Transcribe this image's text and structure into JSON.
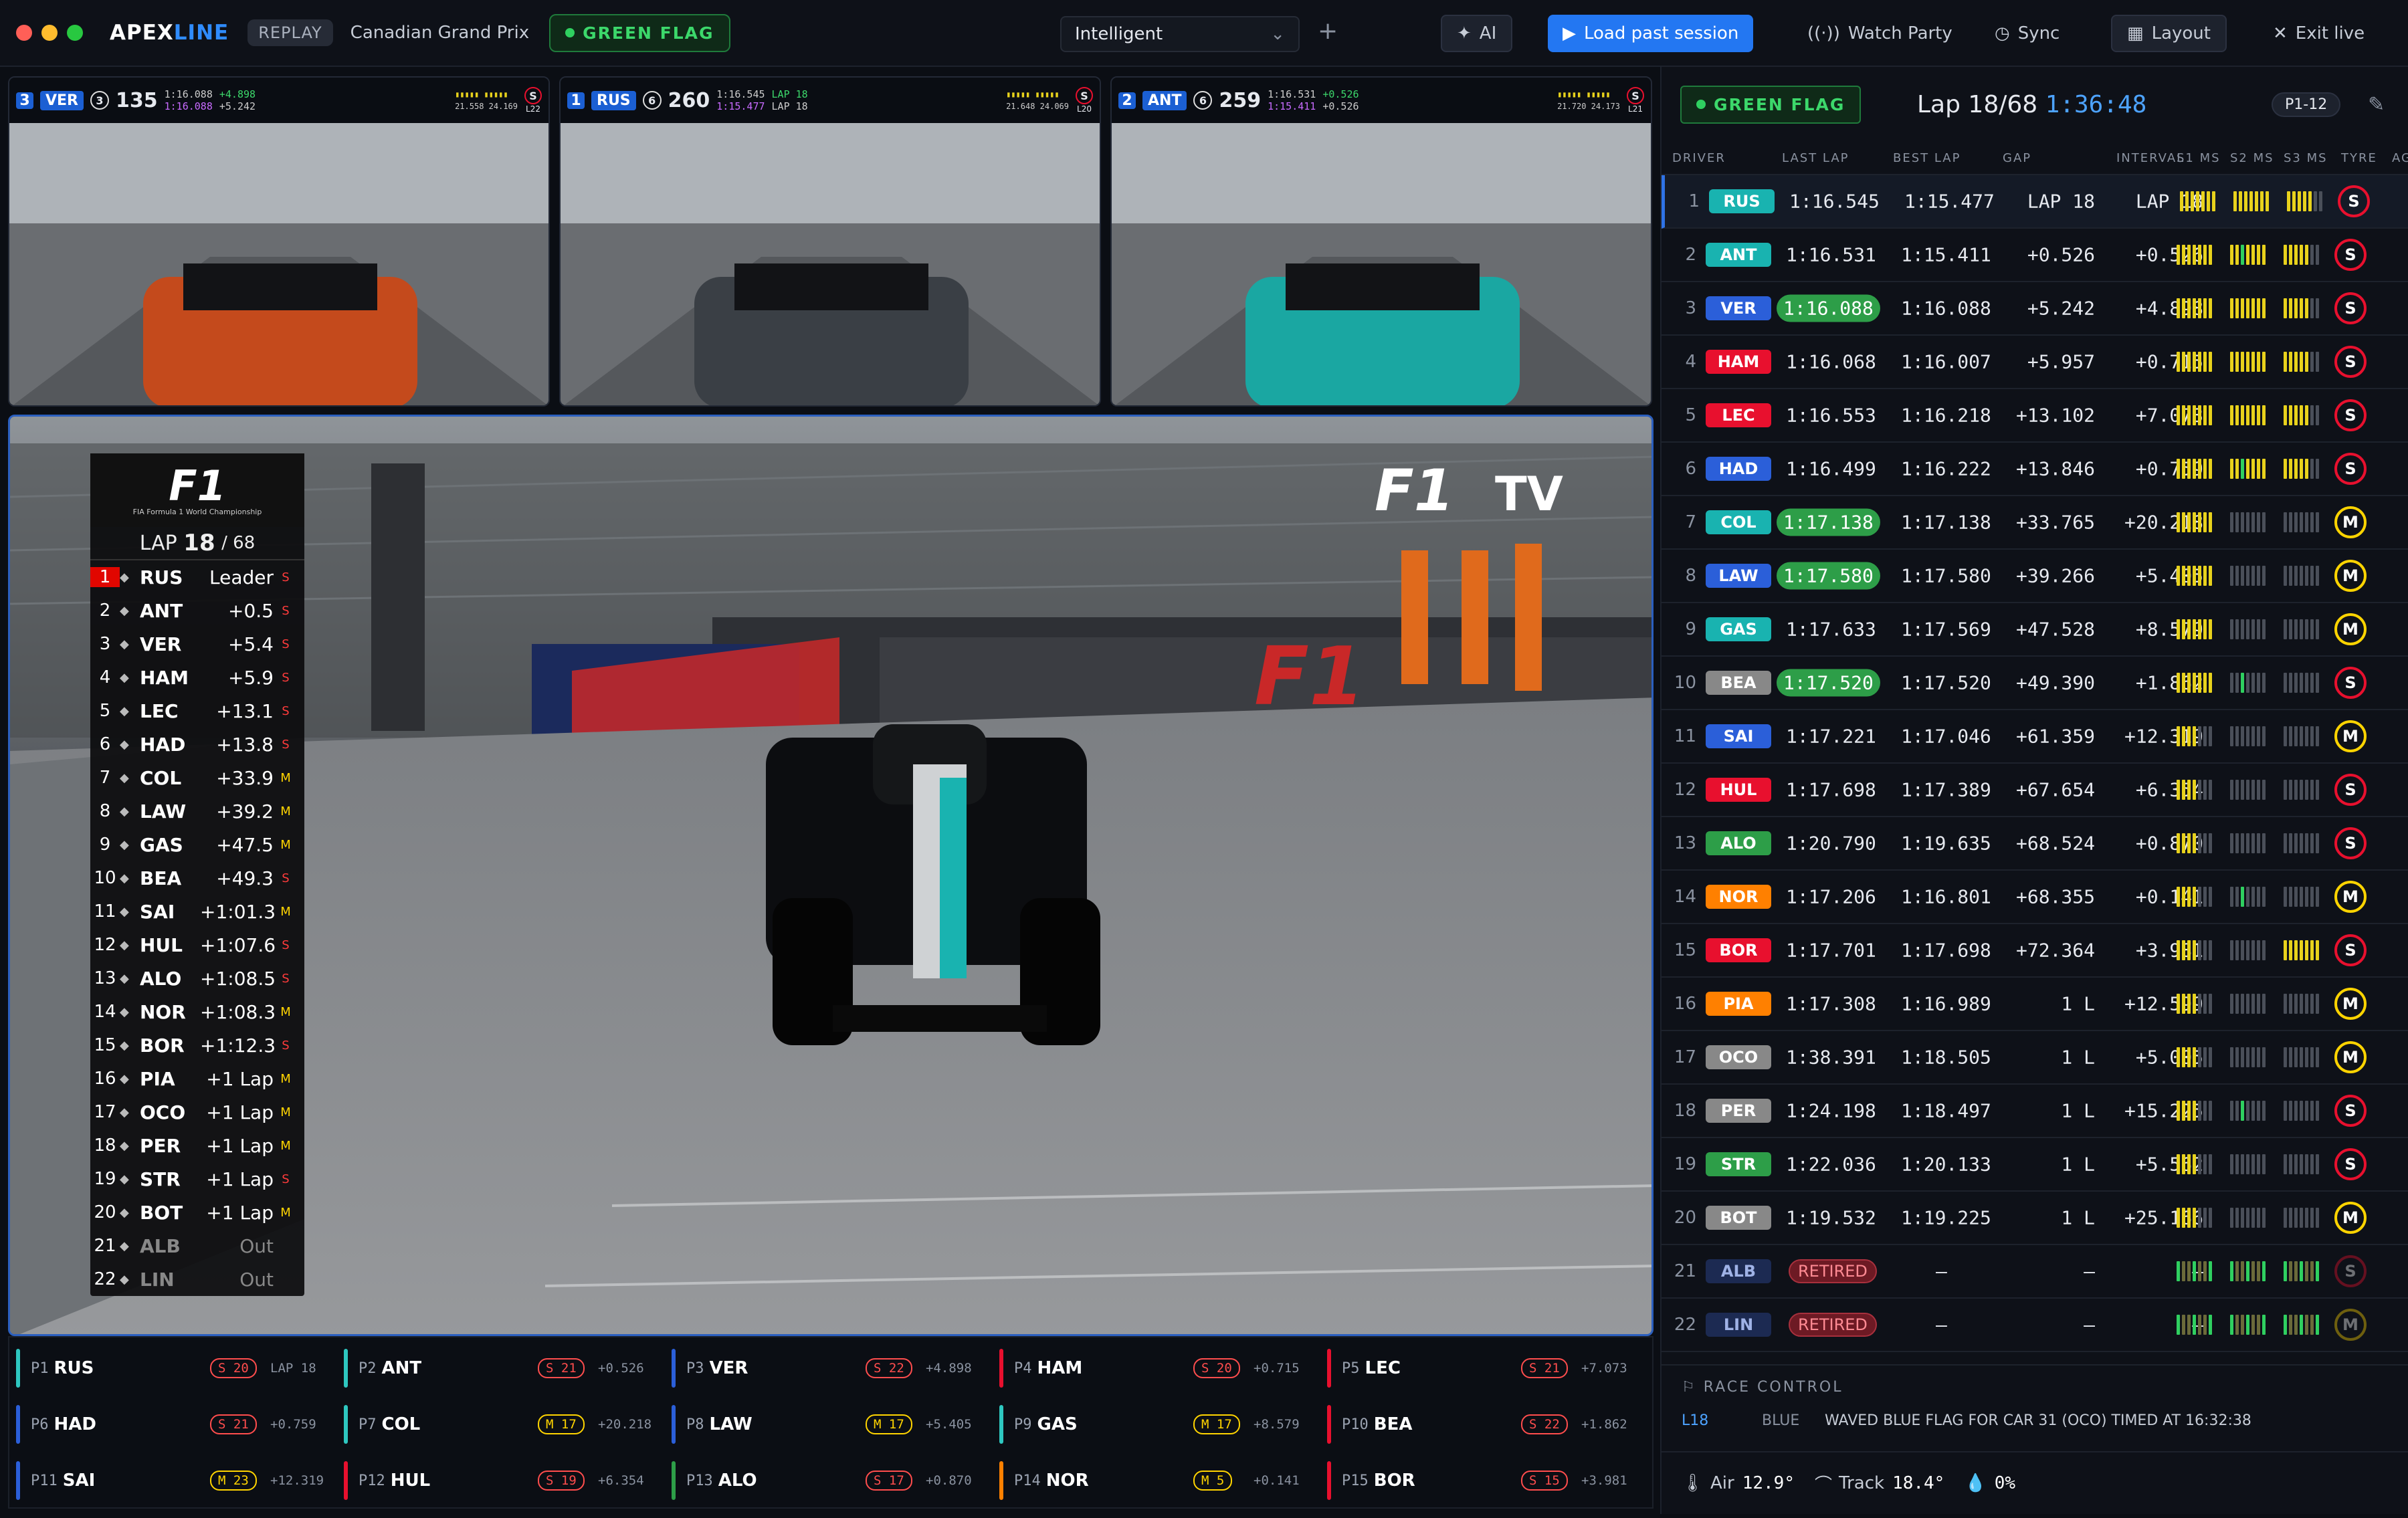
{
  "app": {
    "brand_a": "APEX",
    "brand_b": "LINE",
    "mode_badge": "REPLAY",
    "event": "Canadian Grand Prix",
    "flag": "GREEN FLAG",
    "view_mode": "Intelligent",
    "ai": "AI",
    "load": "Load past session",
    "watch": "Watch Party",
    "sync": "Sync",
    "layout": "Layout",
    "exit": "Exit live"
  },
  "cams": [
    {
      "pos": "3",
      "code": "VER",
      "gear": "3",
      "speed": "135",
      "last": "1:16.088",
      "best": "1:16.088",
      "int": "+4.898",
      "gap": "+5.242",
      "s1": "21.558",
      "s2": "24.169",
      "s3": "21.558 24.169",
      "tyre": "S",
      "age": "L22"
    },
    {
      "pos": "1",
      "code": "RUS",
      "gear": "6",
      "speed": "260",
      "last": "1:16.545",
      "best": "1:15.477",
      "int": "LAP 18",
      "gap": "LAP 18",
      "s1": "21.648",
      "s2": "24.069",
      "s3": "21.648 24.069",
      "tyre": "S",
      "age": "L20"
    },
    {
      "pos": "2",
      "code": "ANT",
      "gear": "6",
      "speed": "259",
      "last": "1:16.531",
      "best": "1:15.411",
      "int": "+0.526",
      "gap": "+0.526",
      "s1": "21.720",
      "s2": "24.173",
      "s3": "21.720 24.173",
      "tyre": "S",
      "age": "L21"
    }
  ],
  "tower": {
    "lap_label": "LAP",
    "lap": "18",
    "total": "/ 68",
    "logo_text": "FIA Formula 1 World Championship",
    "tv": "TV",
    "rows": [
      {
        "p": "1",
        "c": "RUS",
        "g": "Leader",
        "t": "S"
      },
      {
        "p": "2",
        "c": "ANT",
        "g": "+0.5",
        "t": "S"
      },
      {
        "p": "3",
        "c": "VER",
        "g": "+5.4",
        "t": "S"
      },
      {
        "p": "4",
        "c": "HAM",
        "g": "+5.9",
        "t": "S"
      },
      {
        "p": "5",
        "c": "LEC",
        "g": "+13.1",
        "t": "S"
      },
      {
        "p": "6",
        "c": "HAD",
        "g": "+13.8",
        "t": "S"
      },
      {
        "p": "7",
        "c": "COL",
        "g": "+33.9",
        "t": "M"
      },
      {
        "p": "8",
        "c": "LAW",
        "g": "+39.2",
        "t": "M"
      },
      {
        "p": "9",
        "c": "GAS",
        "g": "+47.5",
        "t": "M"
      },
      {
        "p": "10",
        "c": "BEA",
        "g": "+49.3",
        "t": "S"
      },
      {
        "p": "11",
        "c": "SAI",
        "g": "+1:01.3",
        "t": "M"
      },
      {
        "p": "12",
        "c": "HUL",
        "g": "+1:07.6",
        "t": "S"
      },
      {
        "p": "13",
        "c": "ALO",
        "g": "+1:08.5",
        "t": "S"
      },
      {
        "p": "14",
        "c": "NOR",
        "g": "+1:08.3",
        "t": "M"
      },
      {
        "p": "15",
        "c": "BOR",
        "g": "+1:12.3",
        "t": "S"
      },
      {
        "p": "16",
        "c": "PIA",
        "g": "+1 Lap",
        "t": "M"
      },
      {
        "p": "17",
        "c": "OCO",
        "g": "+1 Lap",
        "t": "M"
      },
      {
        "p": "18",
        "c": "PER",
        "g": "+1 Lap",
        "t": "M"
      },
      {
        "p": "19",
        "c": "STR",
        "g": "+1 Lap",
        "t": "S"
      },
      {
        "p": "20",
        "c": "BOT",
        "g": "+1 Lap",
        "t": "M"
      },
      {
        "p": "21",
        "c": "ALB",
        "g": "Out",
        "t": ""
      },
      {
        "p": "22",
        "c": "LIN",
        "g": "Out",
        "t": ""
      }
    ]
  },
  "ticker": [
    {
      "p": "P1",
      "c": "RUS",
      "ty": "S 20",
      "gap": "LAP 18",
      "col": "#2ec7c0"
    },
    {
      "p": "P2",
      "c": "ANT",
      "ty": "S 21",
      "gap": "+0.526",
      "col": "#2ec7c0"
    },
    {
      "p": "P3",
      "c": "VER",
      "ty": "S 22",
      "gap": "+4.898",
      "col": "#2b5fd9"
    },
    {
      "p": "P4",
      "c": "HAM",
      "ty": "S 20",
      "gap": "+0.715",
      "col": "#e8102e"
    },
    {
      "p": "P5",
      "c": "LEC",
      "ty": "S 21",
      "gap": "+7.073",
      "col": "#e8102e"
    },
    {
      "p": "P6",
      "c": "HAD",
      "ty": "S 21",
      "gap": "+0.759",
      "col": "#2b5fd9"
    },
    {
      "p": "P7",
      "c": "COL",
      "ty": "M 17",
      "gap": "+20.218",
      "col": "#2ec7c0"
    },
    {
      "p": "P8",
      "c": "LAW",
      "ty": "M 17",
      "gap": "+5.405",
      "col": "#2b5fd9"
    },
    {
      "p": "P9",
      "c": "GAS",
      "ty": "M 17",
      "gap": "+8.579",
      "col": "#2ec7c0"
    },
    {
      "p": "P10",
      "c": "BEA",
      "ty": "S 22",
      "gap": "+1.862",
      "col": "#e8102e"
    },
    {
      "p": "P11",
      "c": "SAI",
      "ty": "M 23",
      "gap": "+12.319",
      "col": "#2b5fd9"
    },
    {
      "p": "P12",
      "c": "HUL",
      "ty": "S 19",
      "gap": "+6.354",
      "col": "#e8102e"
    },
    {
      "p": "P13",
      "c": "ALO",
      "ty": "S 17",
      "gap": "+0.870",
      "col": "#2d9e48"
    },
    {
      "p": "P14",
      "c": "NOR",
      "ty": "M 5",
      "gap": "+0.141",
      "col": "#ff8000"
    },
    {
      "p": "P15",
      "c": "BOR",
      "ty": "S 15",
      "gap": "+3.981",
      "col": "#e8102e"
    }
  ],
  "side": {
    "flag": "GREEN FLAG",
    "lap_label": "Lap",
    "lap": "18/68",
    "clock": "1:36:48",
    "range": "P1-12",
    "cols": [
      "DRIVER",
      "LAST LAP",
      "BEST LAP",
      "GAP",
      "INTERVAL",
      "S1 MS",
      "S2 MS",
      "S3 MS",
      "TYRE",
      "AGE"
    ],
    "rows": [
      {
        "p": "1",
        "c": "RUS",
        "cc": "#19b3b0",
        "last": "1:16.545",
        "best": "1:15.477",
        "gap": "LAP 18",
        "int": "LAP 18",
        "ty": "S",
        "pb": false
      },
      {
        "p": "2",
        "c": "ANT",
        "cc": "#19b3b0",
        "last": "1:16.531",
        "best": "1:15.411",
        "gap": "+0.526",
        "int": "+0.526",
        "ty": "S",
        "pb": false
      },
      {
        "p": "3",
        "c": "VER",
        "cc": "#2b5fd9",
        "last": "1:16.088",
        "best": "1:16.088",
        "gap": "+5.242",
        "int": "+4.898",
        "ty": "S",
        "pb": true
      },
      {
        "p": "4",
        "c": "HAM",
        "cc": "#e8102e",
        "last": "1:16.068",
        "best": "1:16.007",
        "gap": "+5.957",
        "int": "+0.715",
        "ty": "S",
        "pb": false
      },
      {
        "p": "5",
        "c": "LEC",
        "cc": "#e8102e",
        "last": "1:16.553",
        "best": "1:16.218",
        "gap": "+13.102",
        "int": "+7.073",
        "ty": "S",
        "pb": false
      },
      {
        "p": "6",
        "c": "HAD",
        "cc": "#2b5fd9",
        "last": "1:16.499",
        "best": "1:16.222",
        "gap": "+13.846",
        "int": "+0.759",
        "ty": "S",
        "pb": false
      },
      {
        "p": "7",
        "c": "COL",
        "cc": "#19b3b0",
        "last": "1:17.138",
        "best": "1:17.138",
        "gap": "+33.765",
        "int": "+20.218",
        "ty": "M",
        "pb": true
      },
      {
        "p": "8",
        "c": "LAW",
        "cc": "#2b5fd9",
        "last": "1:17.580",
        "best": "1:17.580",
        "gap": "+39.266",
        "int": "+5.405",
        "ty": "M",
        "pb": true
      },
      {
        "p": "9",
        "c": "GAS",
        "cc": "#19b3b0",
        "last": "1:17.633",
        "best": "1:17.569",
        "gap": "+47.528",
        "int": "+8.579",
        "ty": "M",
        "pb": false
      },
      {
        "p": "10",
        "c": "BEA",
        "cc": "#888",
        "last": "1:17.520",
        "best": "1:17.520",
        "gap": "+49.390",
        "int": "+1.862",
        "ty": "S",
        "pb": true
      },
      {
        "p": "11",
        "c": "SAI",
        "cc": "#2b5fd9",
        "last": "1:17.221",
        "best": "1:17.046",
        "gap": "+61.359",
        "int": "+12.319",
        "ty": "M",
        "pb": false
      },
      {
        "p": "12",
        "c": "HUL",
        "cc": "#e8102e",
        "last": "1:17.698",
        "best": "1:17.389",
        "gap": "+67.654",
        "int": "+6.354",
        "ty": "S",
        "pb": false
      },
      {
        "p": "13",
        "c": "ALO",
        "cc": "#2d9e48",
        "last": "1:20.790",
        "best": "1:19.635",
        "gap": "+68.524",
        "int": "+0.870",
        "ty": "S",
        "pb": false
      },
      {
        "p": "14",
        "c": "NOR",
        "cc": "#ff8000",
        "last": "1:17.206",
        "best": "1:16.801",
        "gap": "+68.355",
        "int": "+0.141",
        "ty": "M",
        "pb": false
      },
      {
        "p": "15",
        "c": "BOR",
        "cc": "#e8102e",
        "last": "1:17.701",
        "best": "1:17.698",
        "gap": "+72.364",
        "int": "+3.981",
        "ty": "S",
        "pb": false
      },
      {
        "p": "16",
        "c": "PIA",
        "cc": "#ff8000",
        "last": "1:17.308",
        "best": "1:16.989",
        "gap": "1 L",
        "int": "+12.599",
        "ty": "M",
        "pb": false
      },
      {
        "p": "17",
        "c": "OCO",
        "cc": "#888",
        "last": "1:38.391",
        "best": "1:18.505",
        "gap": "1 L",
        "int": "+5.005",
        "ty": "M",
        "pb": false
      },
      {
        "p": "18",
        "c": "PER",
        "cc": "#888",
        "last": "1:24.198",
        "best": "1:18.497",
        "gap": "1 L",
        "int": "+15.225",
        "ty": "S",
        "pb": false
      },
      {
        "p": "19",
        "c": "STR",
        "cc": "#2d9e48",
        "last": "1:22.036",
        "best": "1:20.133",
        "gap": "1 L",
        "int": "+5.562",
        "ty": "S",
        "pb": false
      },
      {
        "p": "20",
        "c": "BOT",
        "cc": "#888",
        "last": "1:19.532",
        "best": "1:19.225",
        "gap": "1 L",
        "int": "+25.166",
        "ty": "M",
        "pb": false
      },
      {
        "p": "21",
        "c": "ALB",
        "cc": "#2b5fd9",
        "last": "RETIRED",
        "best": "–",
        "gap": "–",
        "int": "–",
        "ty": "S",
        "pb": false,
        "ret": true
      },
      {
        "p": "22",
        "c": "LIN",
        "cc": "#2b5fd9",
        "last": "RETIRED",
        "best": "–",
        "gap": "–",
        "int": "–",
        "ty": "M",
        "pb": false,
        "ret": true
      }
    ],
    "rc_title": "RACE CONTROL",
    "rc_lap": "L18",
    "rc_type": "BLUE",
    "rc_msg": "WAVED BLUE FLAG FOR CAR 31 (OCO) TIMED AT 16:32:38",
    "air_label": "Air",
    "air": "12.9°",
    "track_label": "Track",
    "track": "18.4°",
    "rain": "0%"
  }
}
